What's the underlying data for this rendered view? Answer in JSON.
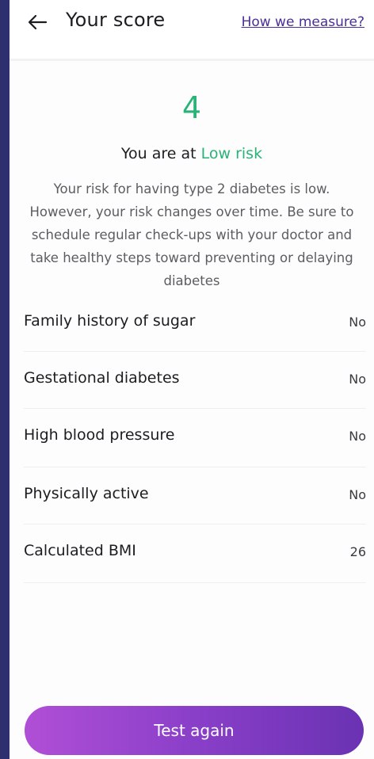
{
  "header": {
    "title": "Your score",
    "link_label": "How we measure?",
    "back_icon": "arrow-left-icon"
  },
  "result": {
    "score": "4",
    "risk_prefix": "You are at",
    "risk_level": "Low risk",
    "description": "Your risk for having type 2 diabetes is low. However, your risk changes over time. Be sure to schedule regular check-ups with your doctor and take healthy steps toward preventing or delaying diabetes"
  },
  "factors": [
    {
      "label": "Family history of sugar",
      "value": "No"
    },
    {
      "label": "Gestational diabetes",
      "value": "No"
    },
    {
      "label": "High blood pressure",
      "value": "No"
    },
    {
      "label": "Physically active",
      "value": "No"
    },
    {
      "label": "Calculated BMI",
      "value": "26"
    }
  ],
  "footer": {
    "button_label": "Test again"
  },
  "colors": {
    "accent_green": "#29b377",
    "link_purple": "#4b2e9a",
    "button_gradient_start": "#b04fd6",
    "button_gradient_end": "#6a32b3"
  }
}
